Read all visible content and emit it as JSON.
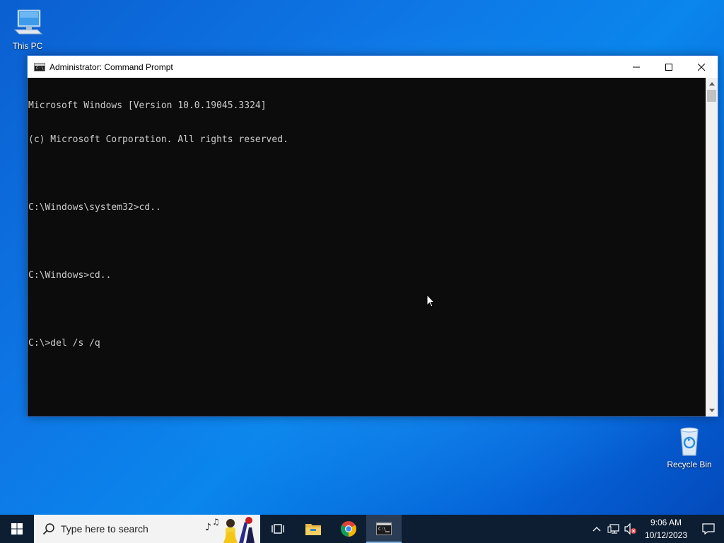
{
  "desktop": {
    "icons": [
      {
        "label": "This PC",
        "icon": "this-pc-icon"
      },
      {
        "label": "Recycle Bin",
        "icon": "recycle-bin-icon"
      }
    ]
  },
  "window": {
    "title": "Administrator: Command Prompt",
    "icon": "cmd-icon",
    "controls": {
      "minimize": "minimize-icon",
      "maximize": "maximize-icon",
      "close": "close-icon"
    },
    "console_lines": [
      "Microsoft Windows [Version 10.0.19045.3324]",
      "(c) Microsoft Corporation. All rights reserved.",
      "",
      "C:\\Windows\\system32>cd..",
      "",
      "C:\\Windows>cd..",
      "",
      "C:\\>del /s /q"
    ],
    "colors": {
      "console_bg": "#0c0c0c",
      "console_text": "#cccccc"
    }
  },
  "taskbar": {
    "search_placeholder": "Type here to search",
    "apps": [
      {
        "name": "Task View",
        "icon": "task-view-icon"
      },
      {
        "name": "File Explorer",
        "icon": "folder-icon"
      },
      {
        "name": "Google Chrome",
        "icon": "chrome-icon"
      },
      {
        "name": "Command Prompt",
        "icon": "cmd-icon",
        "active": true
      }
    ],
    "tray": {
      "time": "9:06 AM",
      "date": "10/12/2023"
    },
    "colors": {
      "taskbar_bg": "#0d1e33",
      "accent": "#7eb4ea"
    }
  }
}
